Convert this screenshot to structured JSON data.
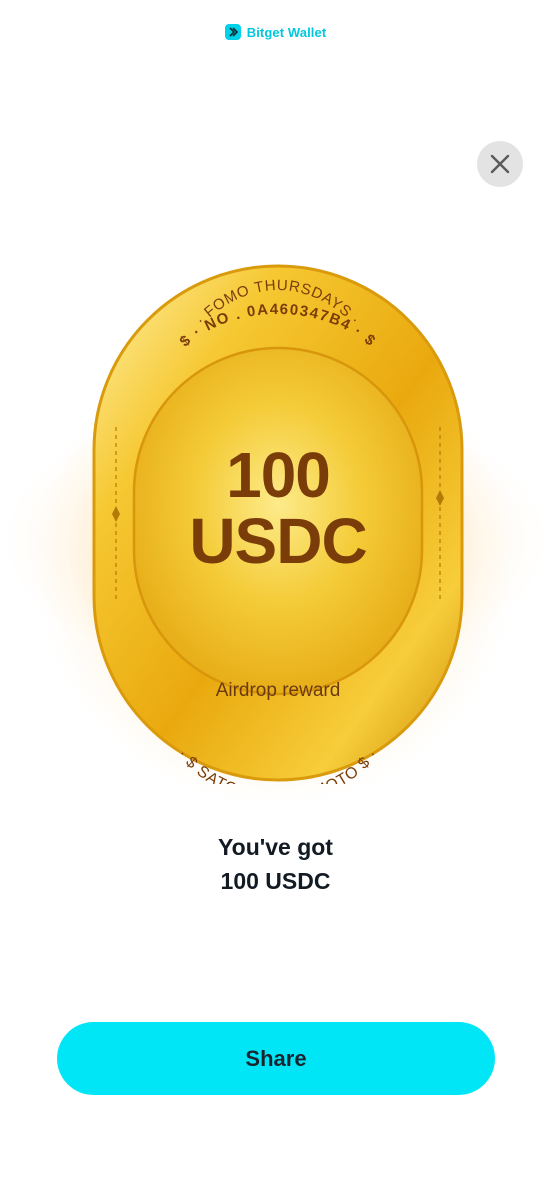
{
  "header": {
    "brand_name": "Bitget Wallet",
    "brand_icon": "bitget-logo-icon",
    "brand_color": "#00c8de"
  },
  "close_button": {
    "icon": "close-icon"
  },
  "coin": {
    "top_arc_text": "· FOMO THURSDAYS ·",
    "serial_text": "$ · NO . 0A460347B4 · $",
    "amount": "100",
    "currency": "USDC",
    "label": "Airdrop reward",
    "bottom_arc_text": "· $ SATOSHI NAKAMOTO $ ·",
    "text_color": "#7a3d0a"
  },
  "result": {
    "line1": "You've got",
    "line2": "100 USDC"
  },
  "share_button": {
    "label": "Share",
    "color": "#00e6f6"
  }
}
